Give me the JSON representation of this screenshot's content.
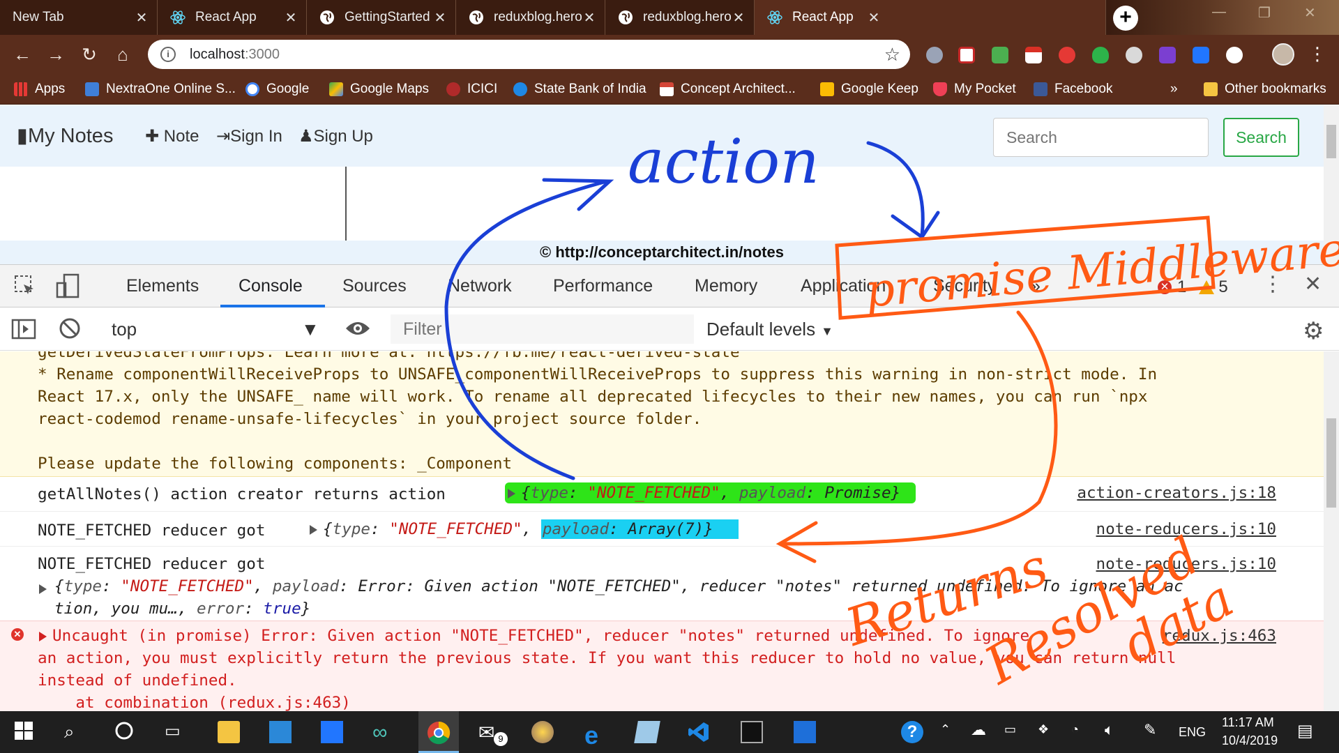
{
  "browser": {
    "tabs": [
      {
        "label": "New Tab",
        "icon": "none"
      },
      {
        "label": "React App",
        "icon": "react-icon"
      },
      {
        "label": "GettingStarted",
        "icon": "globe-icon"
      },
      {
        "label": "reduxblog.herokuapp",
        "icon": "globe-icon"
      },
      {
        "label": "reduxblog.herokuapp",
        "icon": "globe-icon"
      },
      {
        "label": "React App",
        "icon": "react-icon",
        "active": true
      }
    ],
    "url_host": "localhost",
    "url_port": ":3000",
    "bookmarks": [
      {
        "label": "Apps",
        "color": "#e53935"
      },
      {
        "label": "NextraOne Online S...",
        "color": "#3f7fd8"
      },
      {
        "label": "Google",
        "color": "#ffffff"
      },
      {
        "label": "Google Maps",
        "color": "#34a853"
      },
      {
        "label": "ICICI",
        "color": "#b02a2a"
      },
      {
        "label": "State Bank of India",
        "color": "#1e88e5"
      },
      {
        "label": "Concept Architect...",
        "color": "#d44638"
      },
      {
        "label": "Google Keep",
        "color": "#fbbc04"
      },
      {
        "label": "My Pocket",
        "color": "#ef4056"
      },
      {
        "label": "Facebook",
        "color": "#3b5998"
      }
    ],
    "bookmarks_overflow": "»",
    "other_bookmarks": "Other bookmarks"
  },
  "app": {
    "brand": "My Notes",
    "nav": {
      "note": "Note",
      "sign_in": "Sign In",
      "sign_up": "Sign Up"
    },
    "search_placeholder": "Search",
    "search_button": "Search",
    "footer": "© http://conceptarchitect.in/notes"
  },
  "devtools": {
    "tabs": [
      "Elements",
      "Console",
      "Sources",
      "Network",
      "Performance",
      "Memory",
      "Application",
      "Security"
    ],
    "active_tab": "Console",
    "more_tabs": "»",
    "error_count": "1",
    "warning_count": "5",
    "context": "top",
    "filter_placeholder": "Filter",
    "levels": "Default levels"
  },
  "console": {
    "warning_lines": [
      "getDerivedStateFromProps. Learn more at: https://fb.me/react-derived-state",
      "* Rename componentWillReceiveProps to UNSAFE_componentWillReceiveProps to suppress this warning in non-strict mode. In",
      "React 17.x, only the UNSAFE_ name will work. To rename all deprecated lifecycles to their new names, you can run `npx",
      "react-codemod rename-unsafe-lifecycles` in your project source folder.",
      "",
      "Please update the following components: _Component"
    ],
    "log1": {
      "text": "getAllNotes() action creator returns action",
      "type_key": "type",
      "type_value": "\"NOTE_FETCHED\"",
      "payload_key": "payload",
      "payload_value": "Promise",
      "source": "action-creators.js:18"
    },
    "log2": {
      "text": "NOTE_FETCHED reducer got",
      "type_key": "type",
      "type_value": "\"NOTE_FETCHED\"",
      "payload_key": "payload",
      "payload_value": "Array(7)",
      "source": "note-reducers.js:10"
    },
    "log3": {
      "text": "NOTE_FETCHED reducer got",
      "type_key": "type",
      "type_value": "\"NOTE_FETCHED\"",
      "payload_key": "payload",
      "payload_value": "Error: Given action \"NOTE_FETCHED\", reducer \"notes\" returned undefined. To ignore an ac",
      "line2": "tion, you mu…,",
      "error_key": "error",
      "error_value": "true",
      "source": "note-reducers.js:10"
    },
    "error": {
      "line1": "Uncaught (in promise) Error: Given action \"NOTE_FETCHED\", reducer \"notes\" returned undefined. To ignore",
      "line2": "an action, you must explicitly return the previous state. If you want this reducer to hold no value, you can return null",
      "line3": "instead of undefined.",
      "line4": "    at combination (redux.js:463)",
      "source": "redux.js:463"
    }
  },
  "annotations": {
    "action": "action",
    "middleware": "promise Middleware",
    "returns": "Returns",
    "resolved": "Resolved",
    "data": "data",
    "blue_color": "#1a3fd6",
    "orange_color": "#ff5a14"
  },
  "taskbar": {
    "time": "11:17 AM",
    "date": "10/4/2019",
    "lang": "ENG",
    "mail_badge": "9"
  }
}
